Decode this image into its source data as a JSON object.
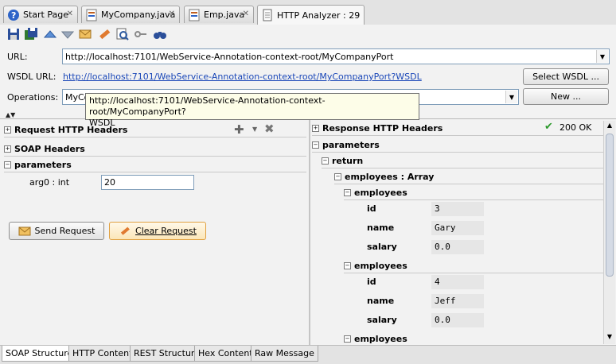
{
  "tabs": [
    {
      "label": "Start Page",
      "icon": "help-icon"
    },
    {
      "label": "MyCompany.java",
      "icon": "java-file-icon"
    },
    {
      "label": "Emp.java",
      "icon": "java-file-icon"
    },
    {
      "label": "HTTP Analyzer : 29",
      "icon": "document-icon"
    }
  ],
  "form": {
    "url_label": "URL:",
    "url_value": "http://localhost:7101/WebService-Annotation-context-root/MyCompanyPort",
    "wsdl_label": "WSDL URL:",
    "wsdl_value": "http://localhost:7101/WebService-Annotation-context-root/MyCompanyPort?WSDL",
    "select_wsdl": "Select WSDL ...",
    "operations_label": "Operations:",
    "operations_value": "MyCo",
    "new_button": "New ..."
  },
  "tooltip": {
    "line1": "http://localhost:7101/WebService-Annotation-context-root/MyCompanyPort?",
    "line2": "WSDL"
  },
  "left": {
    "request_headers": "Request HTTP Headers",
    "soap_headers": "SOAP Headers",
    "parameters": "parameters",
    "arg_label": "arg0 : int",
    "arg_value": "20",
    "send_button": "Send Request",
    "clear_button": "Clear Request"
  },
  "right": {
    "response_headers": "Response HTTP Headers",
    "status": "200 OK",
    "parameters": "parameters",
    "return": "return",
    "employees_array": "employees : Array",
    "employees_label": "employees",
    "records": [
      {
        "id": "3",
        "name": "Gary",
        "salary": "0.0"
      },
      {
        "id": "4",
        "name": "Jeff",
        "salary": "0.0"
      }
    ],
    "field_id": "id",
    "field_name": "name",
    "field_salary": "salary"
  },
  "bottom_tabs": [
    "SOAP Structure",
    "HTTP Content",
    "REST Structure",
    "Hex Content",
    "Raw Message"
  ],
  "colors": {
    "accent": "#1a47b8",
    "ok": "#2e9a2e"
  }
}
